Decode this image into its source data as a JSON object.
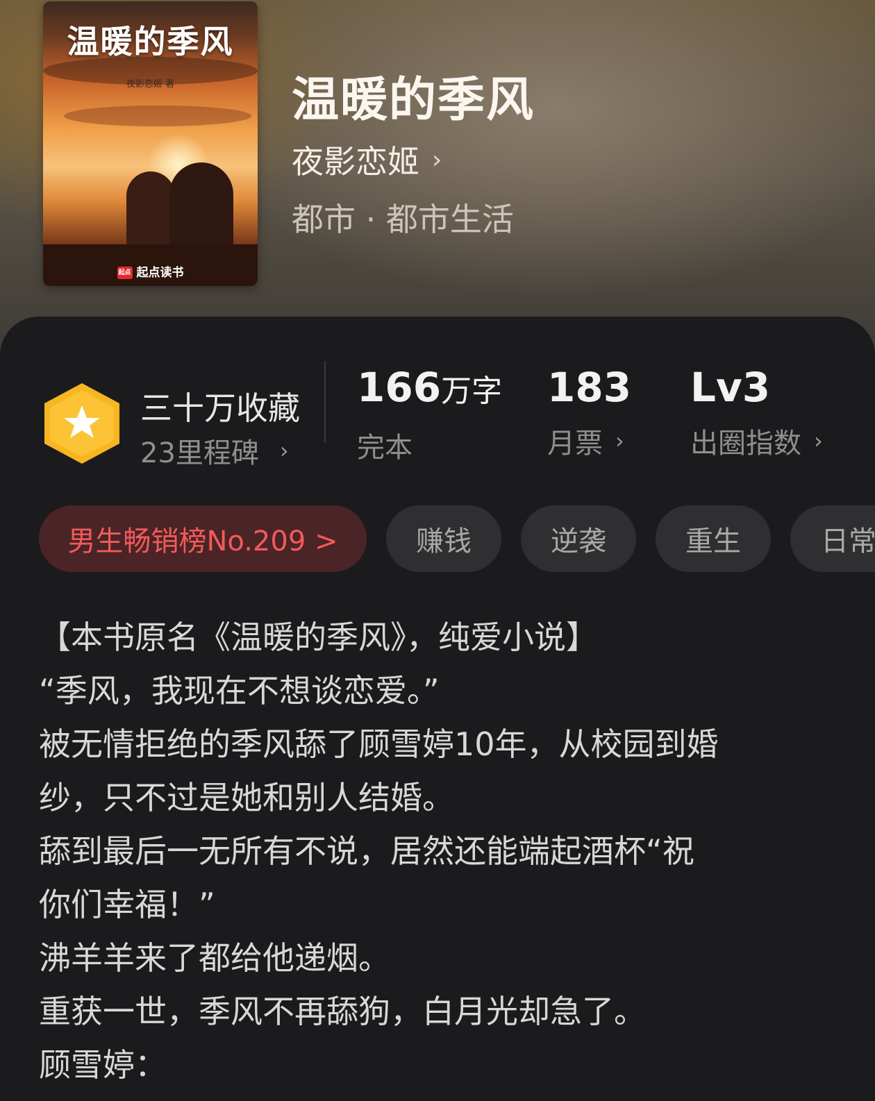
{
  "header": {
    "cover": {
      "title": "温暖的季风",
      "author_line": "夜影恋姬 著",
      "brand": "起点读书",
      "brand_logo_text": "起点"
    },
    "title": "温暖的季风",
    "author": "夜影恋姬",
    "genre": "都市 · 都市生活"
  },
  "stats": {
    "favorites": {
      "main": "三十万收藏",
      "sub": "23里程碑",
      "icon": "star-badge-icon",
      "badge_color": "#f7b522"
    },
    "words": {
      "value": "166",
      "unit": "万字",
      "label": "完本"
    },
    "monthly_tickets": {
      "value": "183",
      "label": "月票"
    },
    "popularity": {
      "value": "Lv3",
      "label": "出圈指数"
    }
  },
  "tags": {
    "rank": "男生畅销榜No.209 >",
    "items": [
      "赚钱",
      "逆袭",
      "重生",
      "日常"
    ]
  },
  "description": [
    "【本书原名《温暖的季风》，纯爱小说】",
    "“季风，我现在不想谈恋爱。”",
    "被无情拒绝的季风舔了顾雪婷10年，从校园到婚",
    "纱，只不过是她和别人结婚。",
    "舔到最后一无所有不说，居然还能端起酒杯“祝",
    "你们幸福！”",
    "沸羊羊来了都给他递烟。",
    "重获一世，季风不再舔狗，白月光却急了。",
    "顾雪婷："
  ],
  "colors": {
    "accent_red": "#f25a5a",
    "panel_bg": "#1b1b1d",
    "chip_bg": "#2f2f31"
  }
}
